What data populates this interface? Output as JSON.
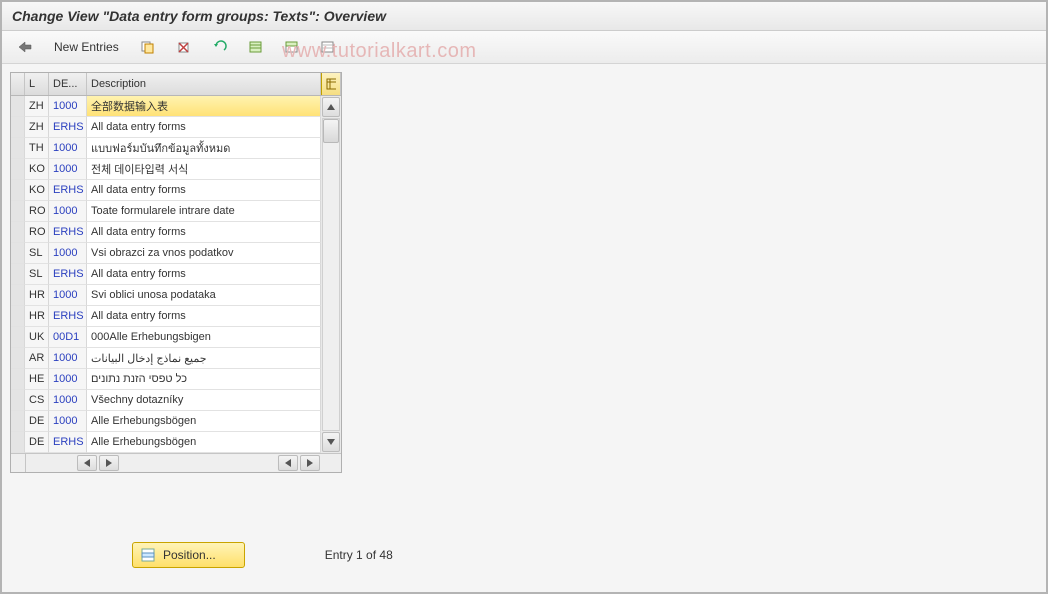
{
  "title": "Change View \"Data entry form groups: Texts\": Overview",
  "watermark": "www.tutorialkart.com",
  "toolbar": {
    "new_entries_label": "New Entries"
  },
  "columns": {
    "sel": "",
    "lang": "L",
    "de": "DE...",
    "desc": "Description"
  },
  "rows": [
    {
      "l": "ZH",
      "de": "1000",
      "desc": "全部数据输入表"
    },
    {
      "l": "ZH",
      "de": "ERHS",
      "desc": "All data entry forms"
    },
    {
      "l": "TH",
      "de": "1000",
      "desc": "แบบฟอร์มบันทึกข้อมูลทั้งหมด"
    },
    {
      "l": "KO",
      "de": "1000",
      "desc": "전체 데이타입력 서식"
    },
    {
      "l": "KO",
      "de": "ERHS",
      "desc": "All data entry forms"
    },
    {
      "l": "RO",
      "de": "1000",
      "desc": "Toate formularele intrare date"
    },
    {
      "l": "RO",
      "de": "ERHS",
      "desc": "All data entry forms"
    },
    {
      "l": "SL",
      "de": "1000",
      "desc": "Vsi obrazci za vnos podatkov"
    },
    {
      "l": "SL",
      "de": "ERHS",
      "desc": "All data entry forms"
    },
    {
      "l": "HR",
      "de": "1000",
      "desc": "Svi oblici unosa podataka"
    },
    {
      "l": "HR",
      "de": "ERHS",
      "desc": "All data entry forms"
    },
    {
      "l": "UK",
      "de": "00D1",
      "desc": "000Alle Erhebungsbigen"
    },
    {
      "l": "AR",
      "de": "1000",
      "desc": "جميع نماذج إدخال البيانات"
    },
    {
      "l": "HE",
      "de": "1000",
      "desc": "כל טפסי הזנת נתונים"
    },
    {
      "l": "CS",
      "de": "1000",
      "desc": "Všechny dotazníky"
    },
    {
      "l": "DE",
      "de": "1000",
      "desc": "Alle Erhebungsbögen"
    },
    {
      "l": "DE",
      "de": "ERHS",
      "desc": "Alle Erhebungsbögen"
    }
  ],
  "footer": {
    "position_label": "Position...",
    "entry_text": "Entry 1 of 48"
  }
}
